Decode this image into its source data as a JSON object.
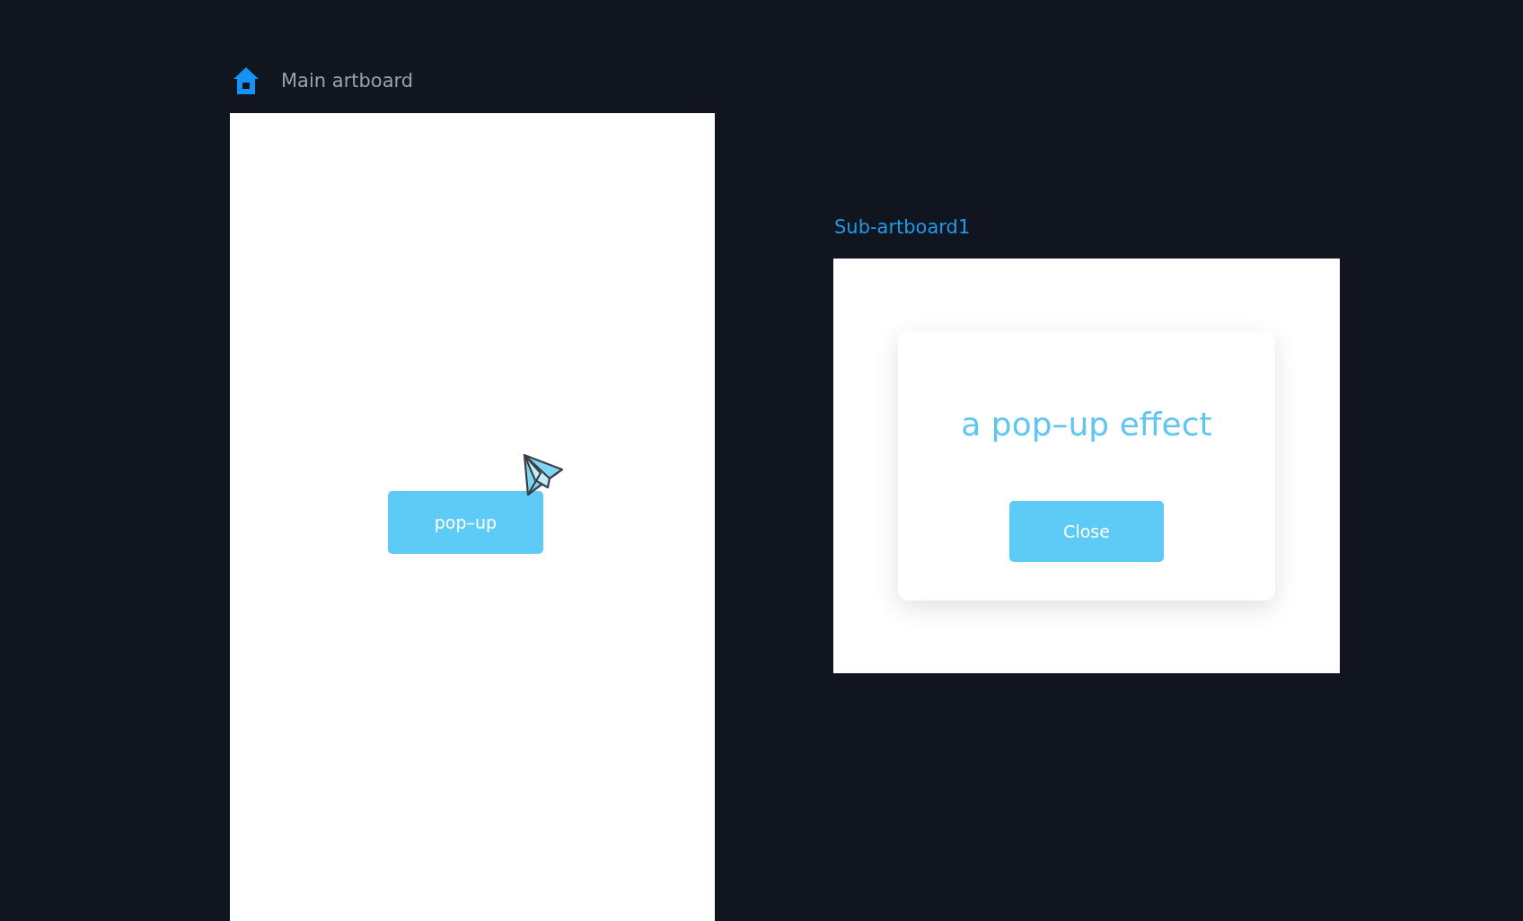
{
  "artboards": [
    {
      "kind": "main",
      "title": "Main artboard",
      "selected": false,
      "button": "pop–up"
    },
    {
      "kind": "sub",
      "title": "Sub-artboard1",
      "selected": true,
      "dialog": {
        "heading": "a pop–up effect",
        "button": "Close"
      }
    }
  ]
}
